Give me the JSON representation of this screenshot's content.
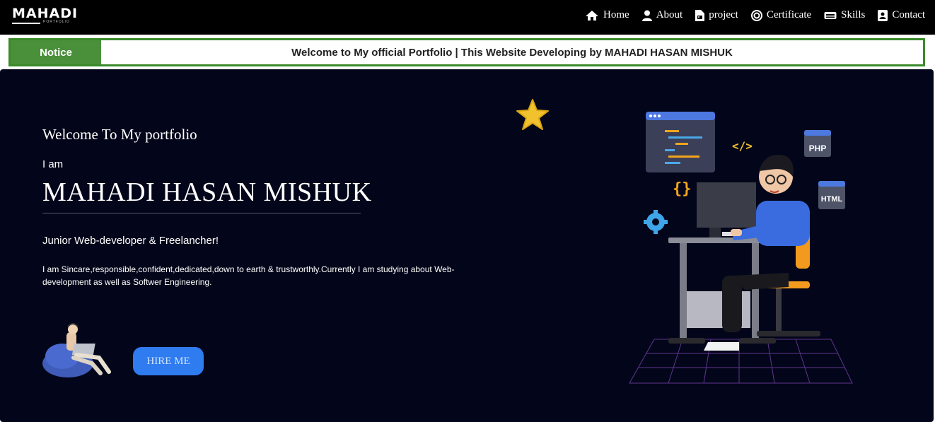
{
  "brand": {
    "name": "MAHADI",
    "tagline": "PORTFOLIO"
  },
  "nav": [
    {
      "label": "Home",
      "icon": "home-icon"
    },
    {
      "label": "About",
      "icon": "user-icon"
    },
    {
      "label": "project",
      "icon": "file-icon"
    },
    {
      "label": "Certificate",
      "icon": "certificate-icon"
    },
    {
      "label": "Skills",
      "icon": "keyboard-icon"
    },
    {
      "label": "Contact",
      "icon": "contact-card-icon"
    }
  ],
  "notice": {
    "tag": "Notice",
    "text": "Welcome to My official Portfolio | This Website Developing by MAHADI HASAN MISHUK"
  },
  "hero": {
    "welcome": "Welcome To My portfolio",
    "intro": "I am",
    "name": "MAHADI HASAN MISHUK",
    "role": "Junior Web-developer & Freelancher!",
    "bio": "I am Sincare,responsible,confident,dedicated,down to earth & trustworthly.Currently I am studying about Web-development as well as Softwer Engineering.",
    "hire_label": "HIRE ME",
    "badges": {
      "php": "PHP",
      "html": "HTML"
    }
  },
  "colors": {
    "navbar": "#000000",
    "notice_border": "#3a8a2a",
    "notice_tag": "#4a8f3a",
    "hero_bg": "#03061a",
    "accent": "#2f7bf0"
  }
}
